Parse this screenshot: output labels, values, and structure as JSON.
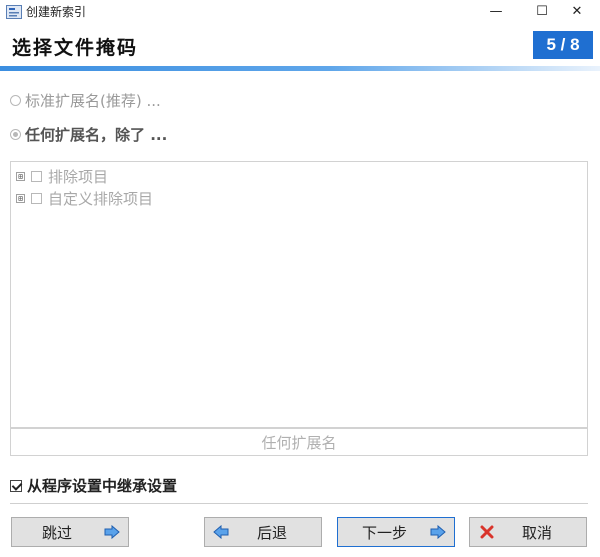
{
  "window": {
    "title": "创建新索引",
    "minimize": "—",
    "maximize": "☐",
    "close": "✕"
  },
  "header": {
    "title": "选择文件掩码",
    "step": "5 / 8",
    "accent_color": "#1f6fd1"
  },
  "options": {
    "standard": {
      "label": "标准扩展名(推荐) ...",
      "selected": false
    },
    "any_except": {
      "label": "任何扩展名，除了 ...",
      "selected": true
    }
  },
  "tree": {
    "items": [
      {
        "label": "排除项目",
        "expander": "⊞",
        "checked": false
      },
      {
        "label": "自定义排除项目",
        "expander": "⊞",
        "checked": false
      }
    ]
  },
  "extension_field": {
    "label": "任何扩展名"
  },
  "inherit": {
    "label": "从程序设置中继承设置",
    "checked": true
  },
  "buttons": {
    "skip": {
      "label": "跳过",
      "icon": "arrow-right-icon"
    },
    "back": {
      "label": "后退",
      "icon": "arrow-left-icon"
    },
    "next": {
      "label": "下一步",
      "icon": "arrow-right-icon"
    },
    "cancel": {
      "label": "取消",
      "icon": "red-x-icon"
    }
  }
}
